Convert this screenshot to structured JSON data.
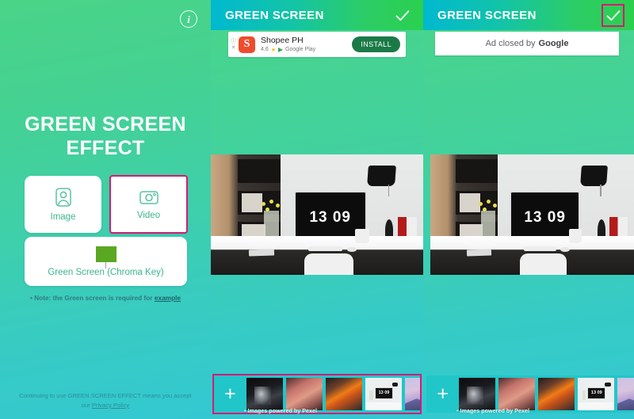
{
  "promo": {
    "info_icon": "info-icon",
    "title_line1": "GREEN SCREEN",
    "title_line2": "EFFECT",
    "options": [
      {
        "label": "Image",
        "icon": "portrait-icon",
        "selected": false
      },
      {
        "label": "Video",
        "icon": "camera-icon",
        "selected": true
      }
    ],
    "green_screen_card": {
      "label": "Green Screen (Chroma Key)",
      "icon": "green-screen-board-icon"
    },
    "note_prefix": "• Note: the Green screen is required for ",
    "note_link": "example",
    "legal_line1": "Continuing to use GREEN SCREEN EFFECT means you accept",
    "legal_line2_prefix": "our ",
    "legal_link": "Privacy Policy"
  },
  "app_middle": {
    "header_title": "GREEN SCREEN",
    "check_icon": "checkmark-icon",
    "ad": {
      "info_mark": "ⓘ",
      "close_mark": "✕",
      "app_icon": "shopee-icon",
      "app_name": "Shopee PH",
      "rating": "4.6",
      "star": "★",
      "store": "Google Play",
      "install_label": "INSTALL"
    },
    "photo": {
      "clock": "13 09",
      "alt": "desk-with-imac-photo"
    },
    "strip": {
      "add_label": "+",
      "credit": "• Images powered by Pexel",
      "thumbs": [
        "smoke-thumb",
        "pink-clouds-thumb",
        "fire-clouds-thumb",
        "desk-imac-thumb",
        "mountain-thumb"
      ],
      "thumb_clock": "13 09"
    }
  },
  "app_right": {
    "header_title": "GREEN SCREEN",
    "check_icon": "checkmark-icon",
    "ad_closed_text": "Ad closed by",
    "ad_closed_brand": "Google",
    "photo": {
      "clock": "13 09",
      "alt": "desk-with-imac-photo"
    },
    "strip": {
      "add_label": "+",
      "credit": "• Images powered by Pexel",
      "thumbs": [
        "smoke-thumb",
        "pink-clouds-thumb",
        "fire-clouds-thumb",
        "desk-imac-thumb",
        "mountain-thumb"
      ],
      "thumb_clock": "13 09"
    }
  },
  "colors": {
    "highlight": "#d41b77",
    "header_cyan": "#00b9d0",
    "header_green": "#2bd04e",
    "bg_green": "#4ad489",
    "bg_teal": "#33c8d2",
    "accent_text": "#3cb68e"
  }
}
